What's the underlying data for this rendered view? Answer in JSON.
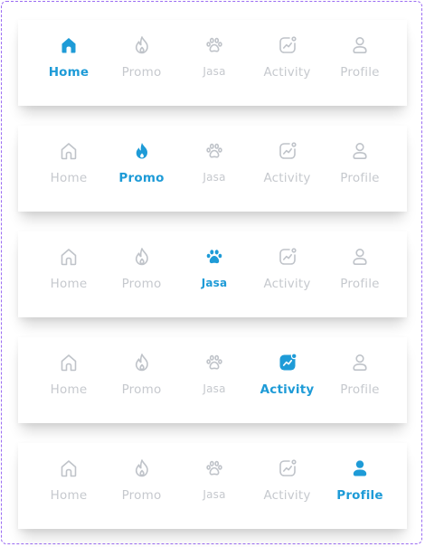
{
  "accent_color": "#1e9bd7",
  "inactive_color": "#c6c9ce",
  "nav_items": [
    {
      "id": "home",
      "label": "Home",
      "icon": "home-icon"
    },
    {
      "id": "promo",
      "label": "Promo",
      "icon": "flame-icon"
    },
    {
      "id": "jasa",
      "label": "Jasa",
      "icon": "paw-icon"
    },
    {
      "id": "activity",
      "label": "Activity",
      "icon": "activity-chart-icon"
    },
    {
      "id": "profile",
      "label": "Profile",
      "icon": "user-icon"
    }
  ],
  "bars": [
    {
      "active": "home"
    },
    {
      "active": "promo"
    },
    {
      "active": "jasa"
    },
    {
      "active": "activity"
    },
    {
      "active": "profile"
    }
  ]
}
